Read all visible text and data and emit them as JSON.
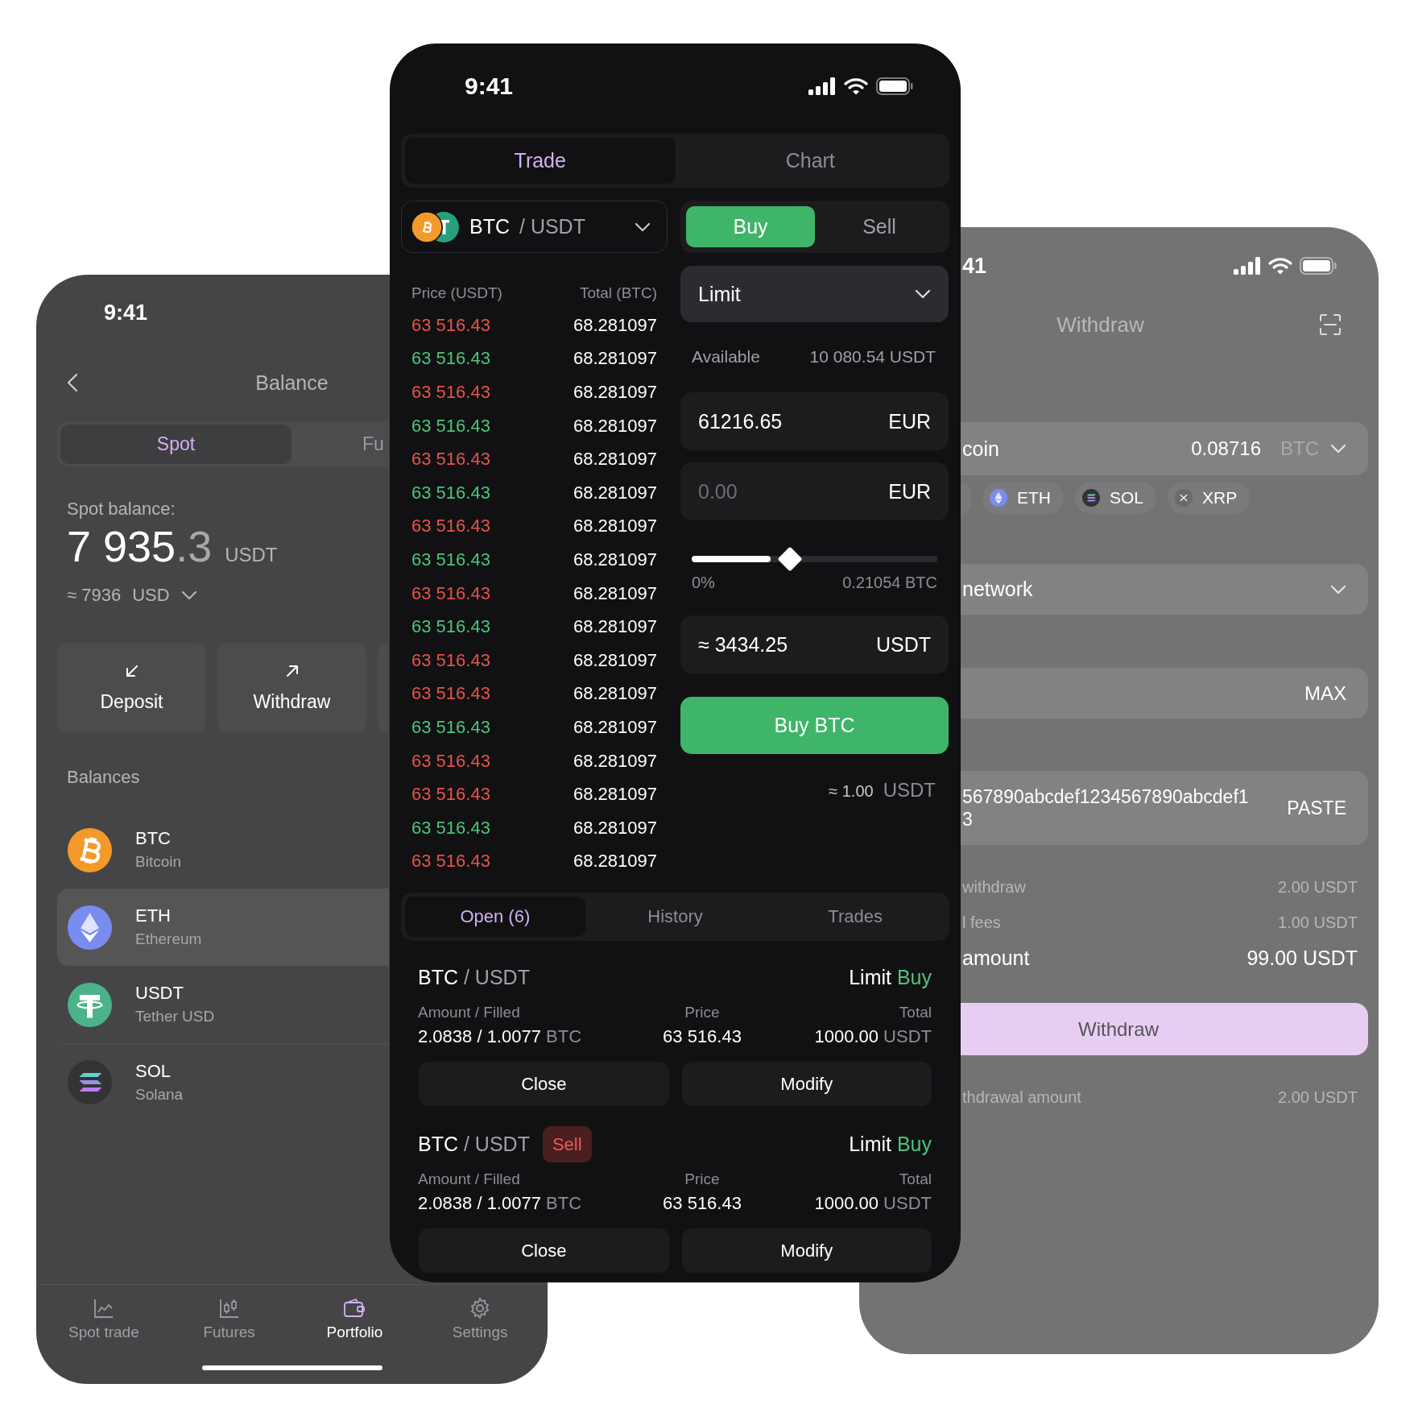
{
  "balance_screen": {
    "status_time": "9:41",
    "title": "Balance",
    "tabs": [
      {
        "label": "Spot",
        "selected": true
      },
      {
        "label": "Fu",
        "selected": false
      }
    ],
    "balance_label": "Spot balance:",
    "balance_whole": "7 935",
    "balance_fraction": ".3",
    "balance_currency": "USDT",
    "converted_value": "≈ 7936",
    "converted_currency": "USD",
    "actions": [
      {
        "label": "Deposit",
        "kind": "deposit"
      },
      {
        "label": "Withdraw",
        "kind": "withdraw"
      }
    ],
    "section_title": "Balances",
    "assets": [
      {
        "symbol": "BTC",
        "name": "Bitcoin",
        "kind": "btc",
        "selected": false
      },
      {
        "symbol": "ETH",
        "name": "Ethereum",
        "kind": "eth",
        "selected": true
      },
      {
        "symbol": "USDT",
        "name": "Tether USD",
        "kind": "usdt",
        "selected": false
      },
      {
        "symbol": "SOL",
        "name": "Solana",
        "kind": "sol",
        "selected": false
      }
    ],
    "nav": [
      {
        "label": "Spot trade",
        "kind": "chart",
        "selected": false
      },
      {
        "label": "Futures",
        "kind": "candles",
        "selected": false
      },
      {
        "label": "Portfolio",
        "kind": "wallet",
        "selected": true
      },
      {
        "label": "Settings",
        "kind": "gear",
        "selected": false
      }
    ]
  },
  "trade_screen": {
    "status_time": "9:41",
    "tabs": [
      {
        "label": "Trade",
        "selected": true
      },
      {
        "label": "Chart",
        "selected": false
      }
    ],
    "pair_base": "BTC",
    "pair_quote": "/ USDT",
    "sides": [
      {
        "label": "Buy",
        "selected": true
      },
      {
        "label": "Sell",
        "selected": false
      }
    ],
    "book_headers": [
      "Price (USDT)",
      "Total (BTC)"
    ],
    "book": [
      {
        "price": "63 516.43",
        "total": "68.281097",
        "kind": "sell"
      },
      {
        "price": "63 516.43",
        "total": "68.281097",
        "kind": "buy"
      },
      {
        "price": "63 516.43",
        "total": "68.281097",
        "kind": "sell"
      },
      {
        "price": "63 516.43",
        "total": "68.281097",
        "kind": "buy"
      },
      {
        "price": "63 516.43",
        "total": "68.281097",
        "kind": "sell"
      },
      {
        "price": "63 516.43",
        "total": "68.281097",
        "kind": "buy"
      },
      {
        "price": "63 516.43",
        "total": "68.281097",
        "kind": "sell"
      },
      {
        "price": "63 516.43",
        "total": "68.281097",
        "kind": "buy"
      },
      {
        "price": "63 516.43",
        "total": "68.281097",
        "kind": "sell"
      },
      {
        "price": "63 516.43",
        "total": "68.281097",
        "kind": "buy"
      },
      {
        "price": "63 516.43",
        "total": "68.281097",
        "kind": "sell"
      },
      {
        "price": "63 516.43",
        "total": "68.281097",
        "kind": "sell"
      },
      {
        "price": "63 516.43",
        "total": "68.281097",
        "kind": "buy"
      },
      {
        "price": "63 516.43",
        "total": "68.281097",
        "kind": "sell"
      },
      {
        "price": "63 516.43",
        "total": "68.281097",
        "kind": "sell"
      },
      {
        "price": "63 516.43",
        "total": "68.281097",
        "kind": "buy"
      },
      {
        "price": "63 516.43",
        "total": "68.281097",
        "kind": "sell"
      }
    ],
    "order_type": "Limit",
    "available_label": "Available",
    "available_value": "10 080.54 USDT",
    "price_field": {
      "value": "61216.65",
      "unit": "EUR"
    },
    "amount_field": {
      "placeholder": "0.00",
      "unit": "EUR"
    },
    "slider": {
      "level": 0.4,
      "min_label": "0%",
      "max_label": "0.21054 BTC"
    },
    "total_field": {
      "value": "≈ 3434.25",
      "unit": "USDT"
    },
    "submit": "Buy BTC",
    "fee": {
      "value": "≈ 1.00",
      "unit": "USDT"
    },
    "order_tabs": [
      {
        "label": "Open (6)",
        "selected": true
      },
      {
        "label": "History",
        "selected": false
      },
      {
        "label": "Trades",
        "selected": false
      }
    ],
    "orders": [
      {
        "base": "BTC",
        "quote": "/ USDT",
        "type": "Limit",
        "side": "Buy",
        "kind": "buy",
        "amount_label": "Amount / Filled",
        "amount": "2.0838 / 1.0077",
        "amount_unit": "BTC",
        "price_label": "Price",
        "price": "63 516.43",
        "total_label": "Total",
        "total": "1000.00",
        "total_unit": "USDT",
        "actions": [
          "Close",
          "Modify"
        ]
      },
      {
        "base": "BTC",
        "quote": "/ USDT",
        "badge": "Sell",
        "type": "Limit",
        "side": "Buy",
        "kind": "buy",
        "amount_label": "Amount / Filled",
        "amount": "2.0838 / 1.0077",
        "amount_unit": "BTC",
        "price_label": "Price",
        "price": "63 516.43",
        "total_label": "Total",
        "total": "1000.00",
        "total_unit": "USDT",
        "actions": [
          "Close",
          "Modify"
        ]
      }
    ]
  },
  "withdraw_screen": {
    "status_time": "41",
    "title": "Withdraw",
    "coin_field": {
      "label": "coin",
      "amount": "0.08716",
      "unit": "BTC"
    },
    "chips": [
      {
        "label": "ETH",
        "kind": "eth"
      },
      {
        "label": "SOL",
        "kind": "sol"
      },
      {
        "label": "XRP",
        "kind": "xrp"
      }
    ],
    "network_field": {
      "label": "network"
    },
    "amount_field": {
      "action": "MAX"
    },
    "address_field": {
      "lines": [
        "567890abcdef1234567890abcdef1",
        "3"
      ],
      "action": "PASTE"
    },
    "summary": [
      {
        "label": "withdraw",
        "value": "2.00 USDT",
        "kind": "muted"
      },
      {
        "label": "l fees",
        "value": "1.00 USDT",
        "kind": "muted"
      },
      {
        "label": "amount",
        "value": "99.00 USDT",
        "kind": "total"
      }
    ],
    "submit": "Withdraw",
    "note": {
      "label": "thdrawal amount",
      "value": "2.00 USDT"
    }
  }
}
